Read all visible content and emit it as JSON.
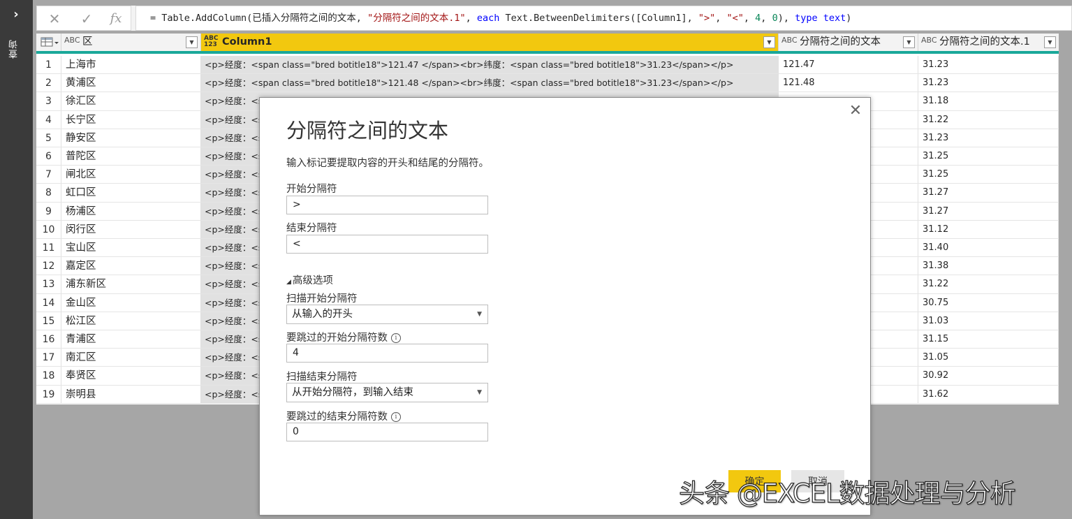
{
  "left_pane": {
    "label": "查询"
  },
  "formula_bar": {
    "cancel_icon": "✕",
    "confirm_icon": "✓",
    "fx_icon": "fx",
    "parts": {
      "p1": "= Table.AddColumn(已插入分隔符之间的文本, ",
      "p2": "\"分隔符之间的文本.1\"",
      "p3": ", ",
      "p4": "each",
      "p5": " Text.BetweenDelimiters([Column1], ",
      "p6": "\">\"",
      "p7": ", ",
      "p8": "\"<\"",
      "p9": ", ",
      "p10": "4",
      "p11": ", ",
      "p12": "0",
      "p13": "), ",
      "p14": "type",
      "p15": " ",
      "p16": "text",
      "p17": ")"
    }
  },
  "grid": {
    "accent_color": "#1aa89a",
    "selected_color": "#f2c80f",
    "headers": {
      "col_qu": {
        "type": "ABC",
        "label": "区"
      },
      "col1": {
        "type_top": "ABC",
        "type_bottom": "123",
        "label": "Column1"
      },
      "col_a": {
        "type": "ABC",
        "label": "分隔符之间的文本"
      },
      "col_b": {
        "type": "ABC",
        "label": "分隔符之间的文本.1"
      }
    },
    "rows": [
      {
        "n": "1",
        "qu": "上海市",
        "col1": "<p>经度：<span class=\"bred botitle18\">121.47 </span><br>纬度：<span class=\"bred botitle18\">31.23</span></p>",
        "a": "121.47",
        "b": "31.23"
      },
      {
        "n": "2",
        "qu": "黄浦区",
        "col1": "<p>经度：<span class=\"bred botitle18\">121.48 </span><br>纬度：<span class=\"bred botitle18\">31.23</span></p>",
        "a": "121.48",
        "b": "31.23"
      },
      {
        "n": "3",
        "qu": "徐汇区",
        "col1": "<p>经度：<s",
        "a": "",
        "b": "31.18"
      },
      {
        "n": "4",
        "qu": "长宁区",
        "col1": "<p>经度：<s",
        "a": "",
        "b": "31.22"
      },
      {
        "n": "5",
        "qu": "静安区",
        "col1": "<p>经度：<s",
        "a": "",
        "b": "31.23"
      },
      {
        "n": "6",
        "qu": "普陀区",
        "col1": "<p>经度：<s",
        "a": "",
        "b": "31.25"
      },
      {
        "n": "7",
        "qu": "闸北区",
        "col1": "<p>经度：<s",
        "a": "",
        "b": "31.25"
      },
      {
        "n": "8",
        "qu": "虹口区",
        "col1": "<p>经度：<s",
        "a": "",
        "b": "31.27"
      },
      {
        "n": "9",
        "qu": "杨浦区",
        "col1": "<p>经度：<s",
        "a": "",
        "b": "31.27"
      },
      {
        "n": "10",
        "qu": "闵行区",
        "col1": "<p>经度：<s",
        "a": "",
        "b": "31.12"
      },
      {
        "n": "11",
        "qu": "宝山区",
        "col1": "<p>经度：<s",
        "a": "",
        "b": "31.40"
      },
      {
        "n": "12",
        "qu": "嘉定区",
        "col1": "<p>经度：<s",
        "a": "",
        "b": "31.38"
      },
      {
        "n": "13",
        "qu": "浦东新区",
        "col1": "<p>经度：<s",
        "a": "",
        "b": "31.22"
      },
      {
        "n": "14",
        "qu": "金山区",
        "col1": "<p>经度：<s",
        "a": "",
        "b": "30.75"
      },
      {
        "n": "15",
        "qu": "松江区",
        "col1": "<p>经度：<s",
        "a": "",
        "b": "31.03"
      },
      {
        "n": "16",
        "qu": "青浦区",
        "col1": "<p>经度：<s",
        "a": "",
        "b": "31.15"
      },
      {
        "n": "17",
        "qu": "南汇区",
        "col1": "<p>经度：<s",
        "a": "",
        "b": "31.05"
      },
      {
        "n": "18",
        "qu": "奉贤区",
        "col1": "<p>经度：<s",
        "a": "",
        "b": "30.92"
      },
      {
        "n": "19",
        "qu": "崇明县",
        "col1": "<p>经度：<s",
        "a": "",
        "b": "31.62"
      }
    ]
  },
  "dialog": {
    "title": "分隔符之间的文本",
    "description": "输入标记要提取内容的开头和结尾的分隔符。",
    "start_delim_label": "开始分隔符",
    "start_delim_value": ">",
    "end_delim_label": "结束分隔符",
    "end_delim_value": "<",
    "advanced_label": "高级选项",
    "scan_start_label": "扫描开始分隔符",
    "scan_start_value": "从输入的开头",
    "skip_start_label": "要跳过的开始分隔符数",
    "skip_start_value": "4",
    "scan_end_label": "扫描结束分隔符",
    "scan_end_value": "从开始分隔符，到输入结束",
    "skip_end_label": "要跳过的结束分隔符数",
    "skip_end_value": "0",
    "ok_label": "确定",
    "cancel_label": "取消"
  },
  "watermark": "头条 @EXCEL数据处理与分析"
}
